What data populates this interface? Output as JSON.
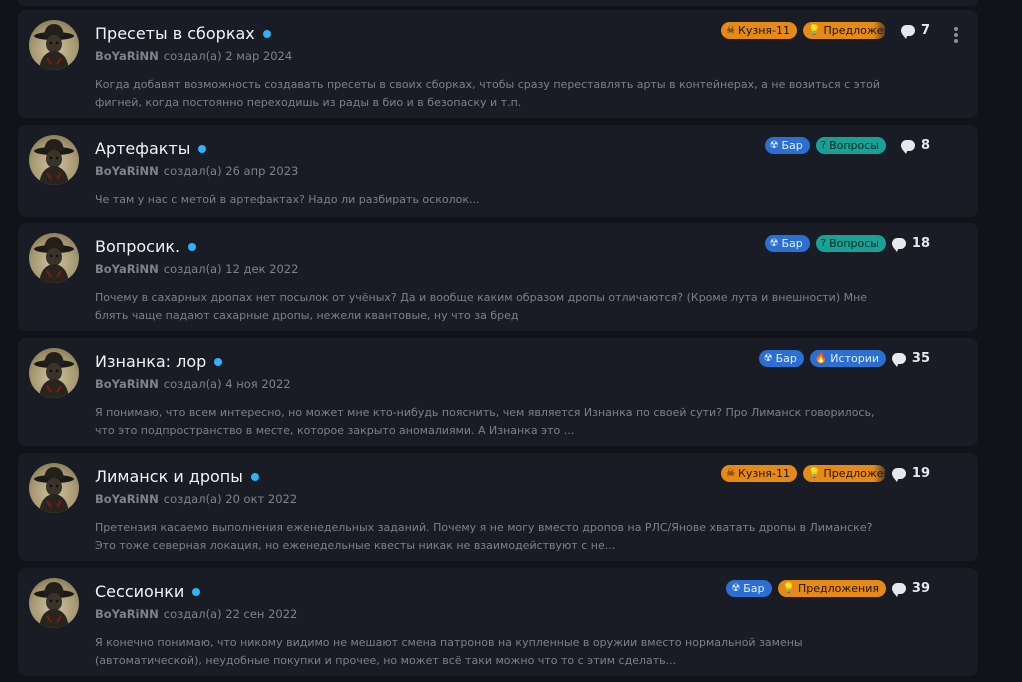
{
  "topics": [
    {
      "title": "Пресеты в сборках",
      "author": "BoYaRiNN",
      "created": "создал(а) 2 мар 2024",
      "excerpt": "Когда добавят возможность создавать пресеты в своих сборках, чтобы сразу переставлять арты в контейнерах, а не возиться с этой фигней, когда постоянно переходишь из рады в био и в безопаску и т.п.",
      "tags": [
        {
          "icon": "skull-icon",
          "glyph": "☠",
          "label": "Кузня-11",
          "color": "#e68a17"
        },
        {
          "icon": "lightbulb-icon",
          "glyph": "💡",
          "label": "Предложен",
          "color": "#e68a17"
        }
      ],
      "replies": "7"
    },
    {
      "title": "Артефакты",
      "author": "BoYaRiNN",
      "created": "создал(а) 26 апр 2023",
      "excerpt": "Че там у нас с метой в артефактах? Надо ли разбирать осколок...",
      "tags": [
        {
          "icon": "radiation-icon",
          "glyph": "☢",
          "label": "Бар",
          "color": "#2a6fd1"
        },
        {
          "icon": "question-icon",
          "glyph": "?",
          "label": "Вопросы",
          "color": "#1aa196"
        }
      ],
      "replies": "8"
    },
    {
      "title": "Вопросик.",
      "author": "BoYaRiNN",
      "created": "создал(а) 12 дек 2022",
      "excerpt": "Почему в сахарных дропах нет посылок от учёных? Да и вообще каким образом дропы отличаются? (Кроме лута и внешности) Мне блять чаще падают сахарные дропы, нежели квантовые, ну что за бред",
      "tags": [
        {
          "icon": "radiation-icon",
          "glyph": "☢",
          "label": "Бар",
          "color": "#2a6fd1"
        },
        {
          "icon": "question-icon",
          "glyph": "?",
          "label": "Вопросы",
          "color": "#1aa196"
        }
      ],
      "replies": "18"
    },
    {
      "title": "Изнанка: лор",
      "author": "BoYaRiNN",
      "created": "создал(а) 4 ноя 2022",
      "excerpt": "Я понимаю, что всем интересно, но может мне кто-нибудь пояснить, чем является Изнанка по своей сути? Про Лиманск говорилось, что это подпространство в месте, которое закрыто аномалиями. А Изнанка это ...",
      "tags": [
        {
          "icon": "radiation-icon",
          "glyph": "☢",
          "label": "Бар",
          "color": "#2a6fd1"
        },
        {
          "icon": "fire-icon",
          "glyph": "🔥",
          "label": "Истории",
          "color": "#2a6fd1"
        }
      ],
      "replies": "35"
    },
    {
      "title": "Лиманск и дропы",
      "author": "BoYaRiNN",
      "created": "создал(а) 20 окт 2022",
      "excerpt": "Претензия касаемо выполнения еженедельных заданий. Почему я не могу вместо дропов на РЛС/Янове хватать дропы в Лиманске? Это тоже северная локация, но еженедельные квесты никак не взаимодействуют с не...",
      "tags": [
        {
          "icon": "skull-icon",
          "glyph": "☠",
          "label": "Кузня-11",
          "color": "#e68a17"
        },
        {
          "icon": "lightbulb-icon",
          "glyph": "💡",
          "label": "Предложен",
          "color": "#e68a17"
        }
      ],
      "replies": "19"
    },
    {
      "title": "Сессионки",
      "author": "BoYaRiNN",
      "created": "создал(а) 22 сен 2022",
      "excerpt": "Я конечно понимаю, что никому видимо не мешают смена патронов на купленные в оружии вместо нормальной замены (автоматической), неудобные покупки и прочее, но может всё таки можно что то с этим сделать...",
      "tags": [
        {
          "icon": "radiation-icon",
          "glyph": "☢",
          "label": "Бар",
          "color": "#2a6fd1"
        },
        {
          "icon": "lightbulb-icon",
          "glyph": "💡",
          "label": "Предложения",
          "color": "#e68a17"
        }
      ],
      "replies": "39"
    }
  ]
}
